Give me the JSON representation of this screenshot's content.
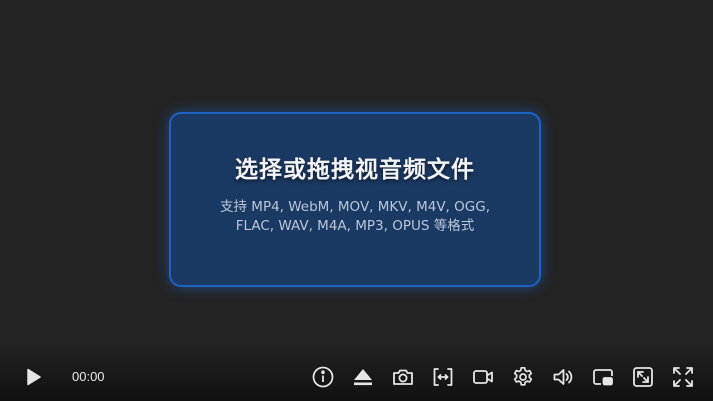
{
  "dropzone": {
    "title": "选择或拖拽视音频文件",
    "description": "支持 MP4, WebM, MOV, MKV, M4V, OGG, FLAC, WAV, M4A, MP3, OPUS 等格式"
  },
  "controls": {
    "time": "00:00",
    "icons": [
      "play-icon",
      "info-icon",
      "eject-icon",
      "camera-icon",
      "aspect-ratio-icon",
      "video-icon",
      "settings-gear-icon",
      "volume-icon",
      "picture-in-picture-icon",
      "expand-icon",
      "fullscreen-icon"
    ]
  },
  "colors": {
    "background": "#232323",
    "dropzone_fill": "#1b3a63",
    "dropzone_border": "#1e63c4",
    "icon": "#e6e6e6"
  }
}
